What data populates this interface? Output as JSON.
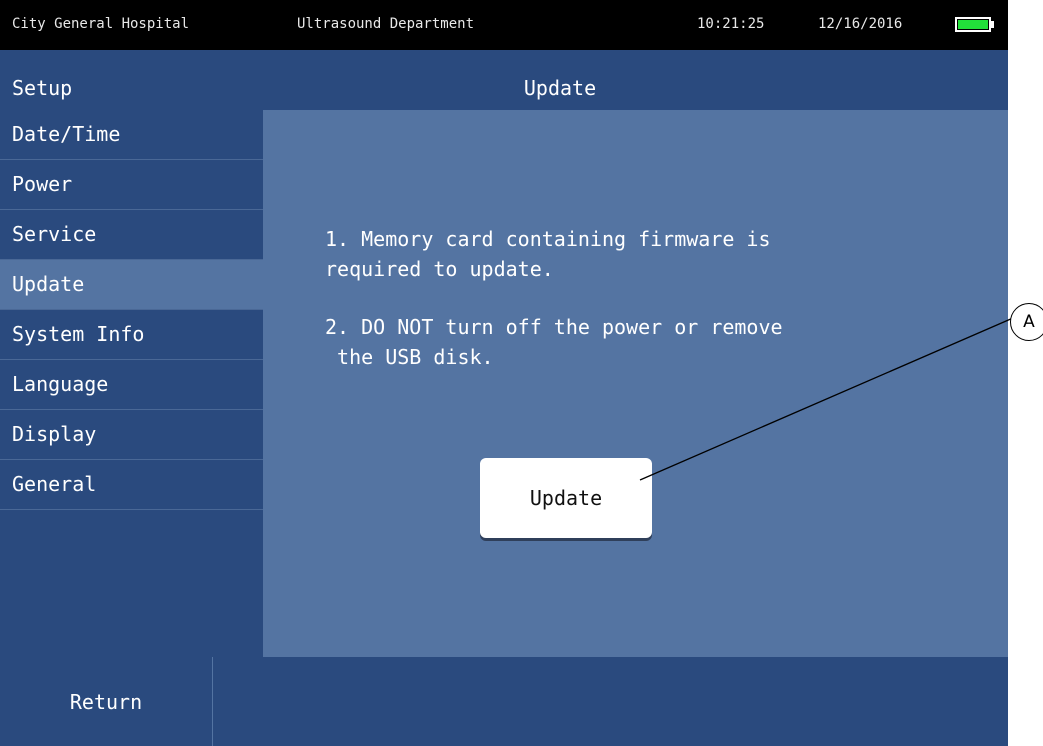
{
  "statusbar": {
    "hospital": "City General Hospital",
    "department": "Ultrasound Department",
    "time": "10:21:25",
    "date": "12/16/2016",
    "battery_level": 1.0,
    "battery_color": "#22e03a"
  },
  "header": {
    "section": "Setup",
    "title": "Update"
  },
  "sidebar": {
    "items": [
      {
        "label": "Date/Time"
      },
      {
        "label": "Power"
      },
      {
        "label": "Service"
      },
      {
        "label": "Update"
      },
      {
        "label": "System Info"
      },
      {
        "label": "Language"
      },
      {
        "label": "Display"
      },
      {
        "label": "General"
      }
    ],
    "active_index": 3
  },
  "main": {
    "note1": "1. Memory card containing firmware is\nrequired to update.",
    "note2": "2. DO NOT turn off the power or remove\n the USB disk.",
    "update_button_label": "Update"
  },
  "footer": {
    "return_label": "Return"
  },
  "callout": {
    "label": "A"
  },
  "colors": {
    "background_dark": "#2a4a7e",
    "background_panel": "#5474a2",
    "statusbar": "#000000",
    "button": "#ffffff"
  }
}
